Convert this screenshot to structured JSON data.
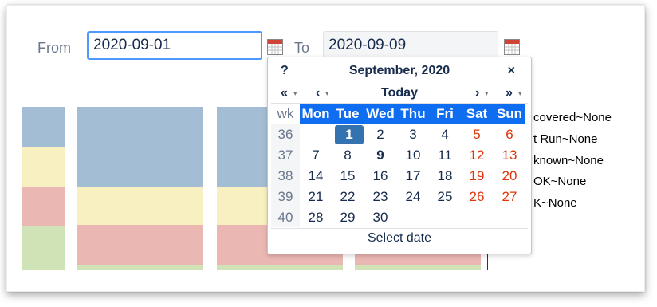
{
  "filters": {
    "from_label": "From",
    "from_value": "2020-09-01",
    "to_label": "To",
    "to_value": "2020-09-09"
  },
  "legend": [
    "covered~None",
    "t Run~None",
    "known~None",
    "OK~None",
    "K~None"
  ],
  "calendar": {
    "help": "?",
    "title": "September, 2020",
    "close": "×",
    "prev_year": "«",
    "prev_month": "‹",
    "today": "Today",
    "next_month": "›",
    "next_year": "»",
    "wk_label": "wk",
    "weekdays": [
      "Mon",
      "Tue",
      "Wed",
      "Thu",
      "Fri",
      "Sat",
      "Sun"
    ],
    "weeks": [
      {
        "wk": "36",
        "days": [
          "",
          "1",
          "2",
          "3",
          "4",
          "5",
          "6"
        ]
      },
      {
        "wk": "37",
        "days": [
          "7",
          "8",
          "9",
          "10",
          "11",
          "12",
          "13"
        ]
      },
      {
        "wk": "38",
        "days": [
          "14",
          "15",
          "16",
          "17",
          "18",
          "19",
          "20"
        ]
      },
      {
        "wk": "39",
        "days": [
          "21",
          "22",
          "23",
          "24",
          "25",
          "26",
          "27"
        ]
      },
      {
        "wk": "40",
        "days": [
          "28",
          "29",
          "30",
          "",
          "",
          "",
          ""
        ]
      }
    ],
    "selected_day": "1",
    "bold_day": "9",
    "footer": "Select date"
  },
  "colors": {
    "blue": "#a3bdd4",
    "yellow": "#f8f0c0",
    "red": "#ebb7b3",
    "green": "#cfe3b6",
    "header": "#0f6df2",
    "weekend": "#de350b",
    "selected": "#3572b0"
  }
}
